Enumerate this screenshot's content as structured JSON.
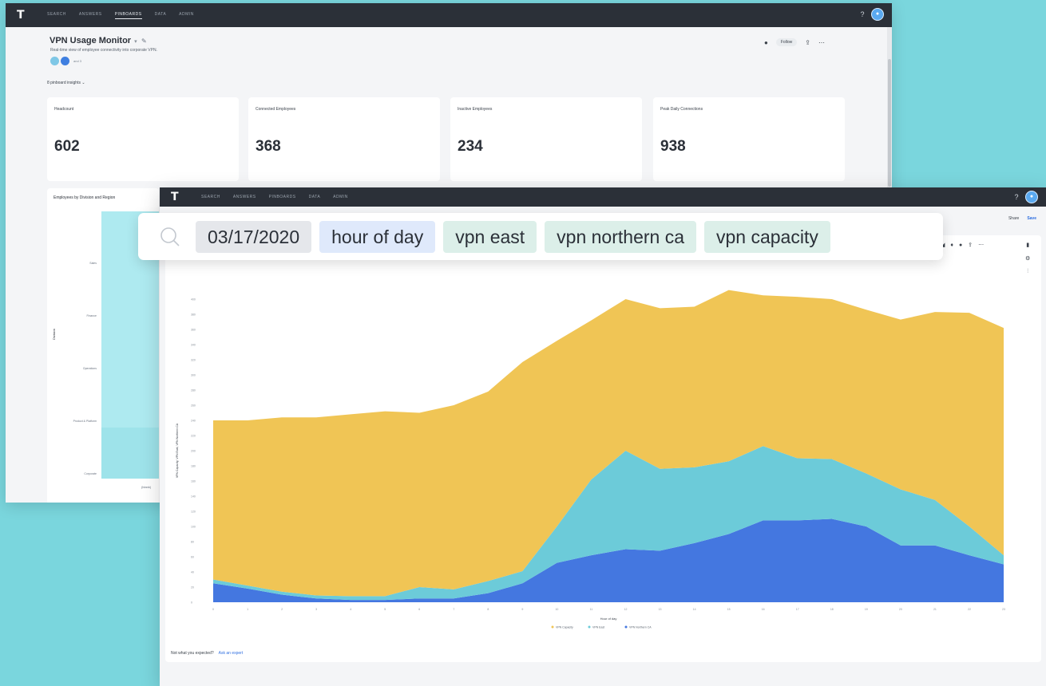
{
  "back_window": {
    "nav": [
      "SEARCH",
      "ANSWERS",
      "PINBOARDS",
      "DATA",
      "ADMIN"
    ],
    "active_nav_index": 2,
    "pinboard_title": "VPN Usage Monitor",
    "pinboard_description": "Real-time view of employee connectivity into corporate VPN.",
    "shared_more": "and 3",
    "follow_label": "Follow",
    "insights_label": "8 pinboard insights",
    "kpis": [
      {
        "label": "Headcount",
        "value": "602"
      },
      {
        "label": "Connected Employees",
        "value": "368"
      },
      {
        "label": "Inactive Employees",
        "value": "234"
      },
      {
        "label": "Peak Daily Connections",
        "value": "938"
      }
    ],
    "division_chart_title": "Employees by Division and Region",
    "division_axis_label": "Division",
    "division_x_label": "(blank)",
    "divisions": [
      "Sales",
      "Finance",
      "Operations",
      "Product & Platform",
      "Corporate"
    ]
  },
  "front_window": {
    "nav": [
      "SEARCH",
      "ANSWERS",
      "PINBOARDS",
      "DATA",
      "ADMIN"
    ],
    "save_label": "Save",
    "share_label": "Share",
    "feedback_text": "Not what you expected?",
    "feedback_link": "Ask an expert"
  },
  "search": {
    "tokens": [
      {
        "text": "03/17/2020",
        "kind": "date"
      },
      {
        "text": "hour of day",
        "kind": "attr"
      },
      {
        "text": "vpn east",
        "kind": "measure"
      },
      {
        "text": "vpn northern ca",
        "kind": "measure"
      },
      {
        "text": "vpn capacity",
        "kind": "measure"
      }
    ]
  },
  "colors": {
    "capacity": "#f0c555",
    "east": "#6ccbd9",
    "northern_ca": "#4477e0",
    "background": "#7ad6dd"
  },
  "icons": [
    "search-icon",
    "help-icon",
    "lightbulb-icon",
    "share-icon",
    "more-icon",
    "gear-icon",
    "pencil-icon"
  ],
  "chart_data": {
    "type": "area",
    "x": [
      "0",
      "1",
      "2",
      "3",
      "4",
      "5",
      "6",
      "7",
      "8",
      "9",
      "10",
      "11",
      "12",
      "13",
      "14",
      "15",
      "16",
      "17",
      "18",
      "19",
      "20",
      "21",
      "22",
      "23"
    ],
    "xlabel": "Hour of day",
    "ylabel": "VPN Capacity, VPN East, VPN Northern CA",
    "ylim": [
      0,
      400
    ],
    "series": [
      {
        "name": "VPN Northern CA",
        "values": [
          25,
          18,
          10,
          5,
          3,
          3,
          5,
          5,
          12,
          25,
          52,
          62,
          70,
          68,
          78,
          90,
          108,
          108,
          110,
          100,
          75,
          75,
          62,
          50
        ]
      },
      {
        "name": "VPN East",
        "values": [
          5,
          4,
          4,
          4,
          5,
          5,
          15,
          12,
          16,
          16,
          48,
          100,
          130,
          108,
          100,
          96,
          98,
          82,
          79,
          70,
          74,
          60,
          38,
          12
        ]
      },
      {
        "name": "VPN Capacity",
        "values": [
          210,
          218,
          230,
          235,
          240,
          244,
          230,
          243,
          250,
          276,
          245,
          210,
          200,
          212,
          212,
          226,
          199,
          213,
          211,
          216,
          224,
          248,
          282,
          300
        ]
      }
    ],
    "legend": "bottom"
  }
}
